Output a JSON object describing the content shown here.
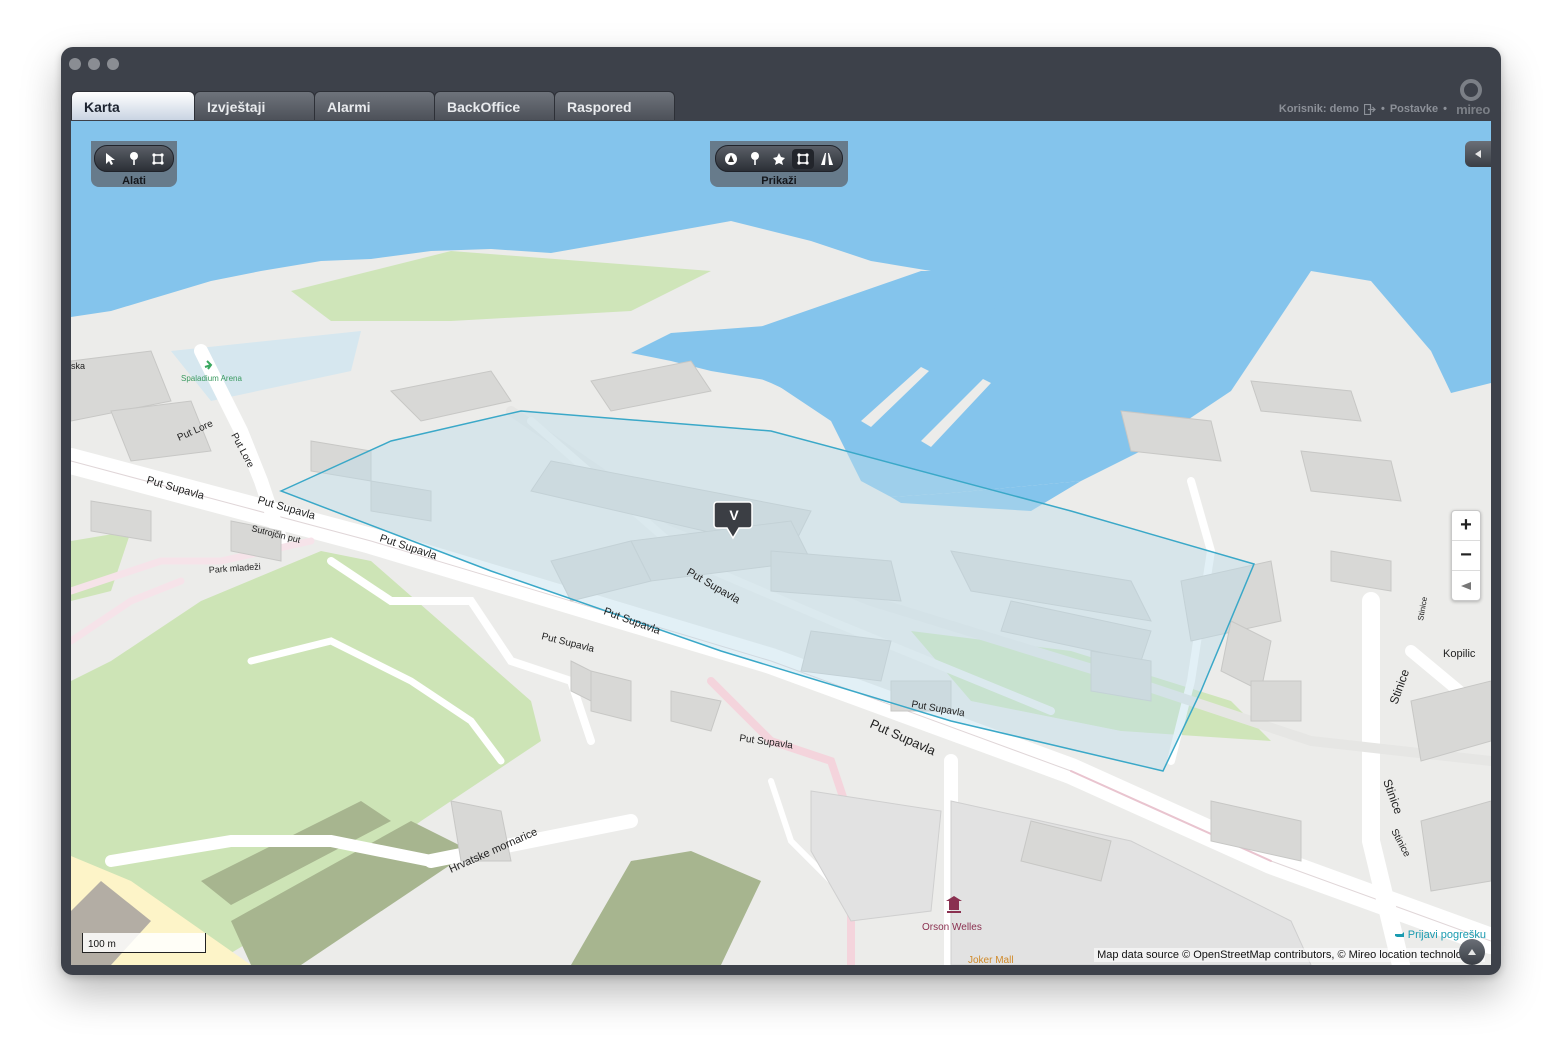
{
  "window": {
    "controls": [
      "close",
      "minimize",
      "zoom"
    ]
  },
  "tabs": [
    {
      "label": "Karta",
      "active": true
    },
    {
      "label": "Izvještaji",
      "active": false
    },
    {
      "label": "Alarmi",
      "active": false
    },
    {
      "label": "BackOffice",
      "active": false
    },
    {
      "label": "Raspored",
      "active": false
    }
  ],
  "userbar": {
    "user_label": "Korisnik: demo",
    "separator": "•",
    "settings_label": "Postavke",
    "logo_text": "mireo"
  },
  "toolbars": {
    "tools": {
      "label": "Alati",
      "buttons": [
        "pointer-icon",
        "pin-icon",
        "area-icon"
      ]
    },
    "show": {
      "label": "Prikaži",
      "buttons": [
        "vehicle-icon",
        "pin-icon",
        "poi-icon",
        "area-icon",
        "road-icon"
      ]
    }
  },
  "map": {
    "roads": {
      "put_supavla": "Put Supavla",
      "put_lore": "Put Lore",
      "sutrocin_put": "Sutrojčin put",
      "park_mladezi": "Park mladeži",
      "hrvatske_mornarice": "Hrvatske mornarice",
      "stinice": "Stinice",
      "kopilica": "Kopilic",
      "ska": "ska"
    },
    "pois": {
      "arena": "Spaladium Arena",
      "orson": "Orson Welles",
      "joker": "Joker Mall"
    },
    "vehicle_marker": "V",
    "zoom": {
      "in": "+",
      "out": "−"
    },
    "scale": "100 m",
    "report_error": "Prijavi pogrešku",
    "attribution": "Map data source © OpenStreetMap contributors, © Mireo location technologies"
  },
  "colors": {
    "water": "#84c4ec",
    "accent": "#1a9bb0",
    "geofence": "#3aa8c8"
  }
}
